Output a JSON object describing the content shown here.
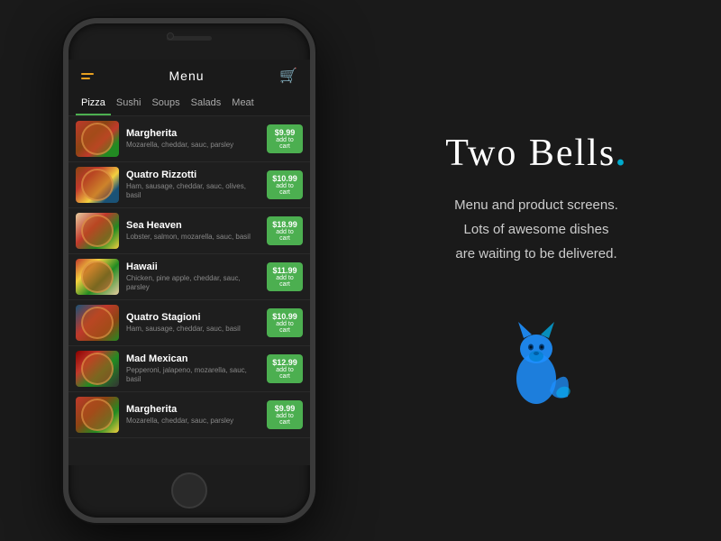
{
  "app": {
    "title": "Menu",
    "brand": {
      "name_part1": "Two Bells",
      "dot": ".",
      "tagline_line1": "Menu and product screens.",
      "tagline_line2": "Lots of awesome dishes",
      "tagline_line3": "are waiting to be delivered."
    }
  },
  "phone": {
    "categories": [
      {
        "label": "Pizza",
        "active": true
      },
      {
        "label": "Sushi",
        "active": false
      },
      {
        "label": "Soups",
        "active": false
      },
      {
        "label": "Salads",
        "active": false
      },
      {
        "label": "Meat",
        "active": false
      }
    ],
    "menu_items": [
      {
        "name": "Margherita",
        "description": "Mozarella, cheddar, sauc, parsley",
        "price": "$9.99",
        "image_class": "pizza-1"
      },
      {
        "name": "Quatro Rizzotti",
        "description": "Ham, sausage, cheddar, sauc, olives, basil",
        "price": "$10.99",
        "image_class": "pizza-2"
      },
      {
        "name": "Sea Heaven",
        "description": "Lobster, salmon, mozarella, sauc, basil",
        "price": "$18.99",
        "image_class": "pizza-3"
      },
      {
        "name": "Hawaii",
        "description": "Chicken, pine apple, cheddar, sauc, parsley",
        "price": "$11.99",
        "image_class": "pizza-4"
      },
      {
        "name": "Quatro Stagioni",
        "description": "Ham, sausage, cheddar, sauc, basil",
        "price": "$10.99",
        "image_class": "pizza-5"
      },
      {
        "name": "Mad Mexican",
        "description": "Pepperoni, jalapeno, mozarella, sauc, basil",
        "price": "$12.99",
        "image_class": "pizza-6"
      },
      {
        "name": "Margherita",
        "description": "Mozarella, cheddar, sauc, parsley",
        "price": "$9.99",
        "image_class": "pizza-7"
      }
    ],
    "add_to_cart_label": "add to cart"
  }
}
